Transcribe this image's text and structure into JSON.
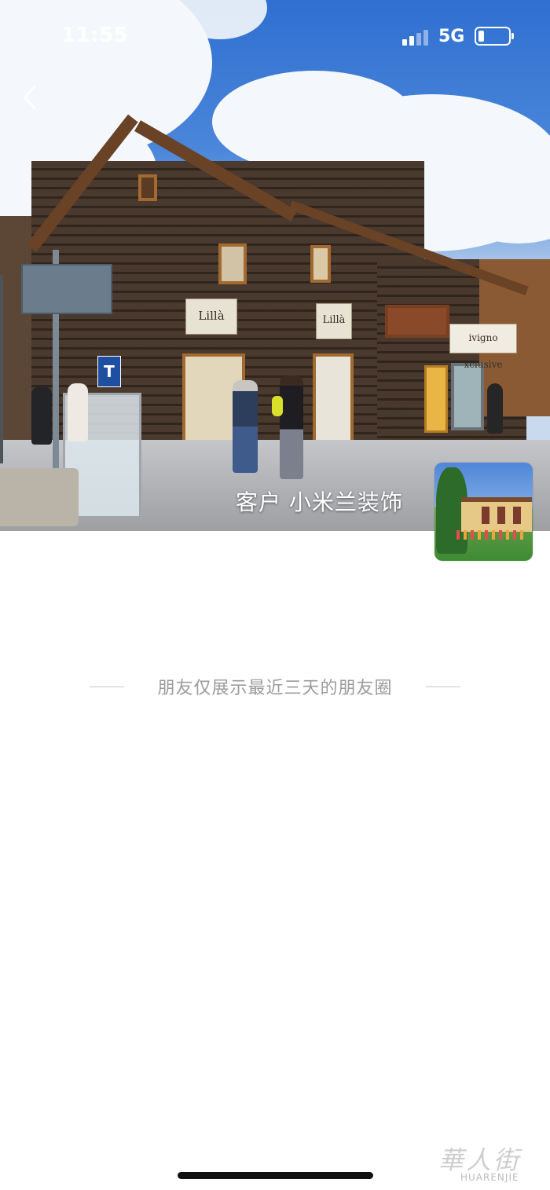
{
  "status_bar": {
    "time": "11:55",
    "network": "5G"
  },
  "profile": {
    "name": "客户 小米兰装饰",
    "cover_signs": [
      "Lillà",
      "Lillà",
      "ivigno xclusive"
    ],
    "cover_letter": "T"
  },
  "notice": {
    "text": "朋友仅展示最近三天的朋友圈"
  },
  "watermark": {
    "glyphs": "華人街",
    "subtitle": "HUARENJIE"
  },
  "icons": {
    "back": "chevron-left-icon",
    "signal": "signal-bars-icon",
    "battery": "battery-icon"
  }
}
